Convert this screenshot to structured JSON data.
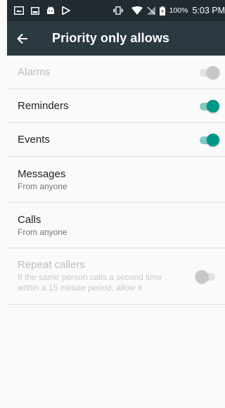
{
  "status_bar": {
    "icons": [
      "screenshot-icon",
      "image-icon",
      "android-icon",
      "play-store-icon",
      "vibrate-icon",
      "wifi-icon",
      "no-sim-icon",
      "battery-icon"
    ],
    "battery": "100%",
    "time": "5:03 PM"
  },
  "toolbar": {
    "title": "Priority only allows",
    "back_icon": "arrow-back-icon"
  },
  "items": [
    {
      "title": "Alarms",
      "enabled": false,
      "switch_on": true
    },
    {
      "title": "Reminders",
      "enabled": true,
      "switch_on": true
    },
    {
      "title": "Events",
      "enabled": true,
      "switch_on": true
    },
    {
      "title": "Messages",
      "subtitle": "From anyone"
    },
    {
      "title": "Calls",
      "subtitle": "From anyone"
    },
    {
      "title": "Repeat callers",
      "subtitle": "If the same person calls a second time within a 15 minute period, allow it",
      "enabled": false,
      "switch_on": false
    }
  ],
  "colors": {
    "status_bar": "#222b31",
    "toolbar": "#2b3940",
    "accent": "#009688",
    "background": "#fafafa"
  }
}
